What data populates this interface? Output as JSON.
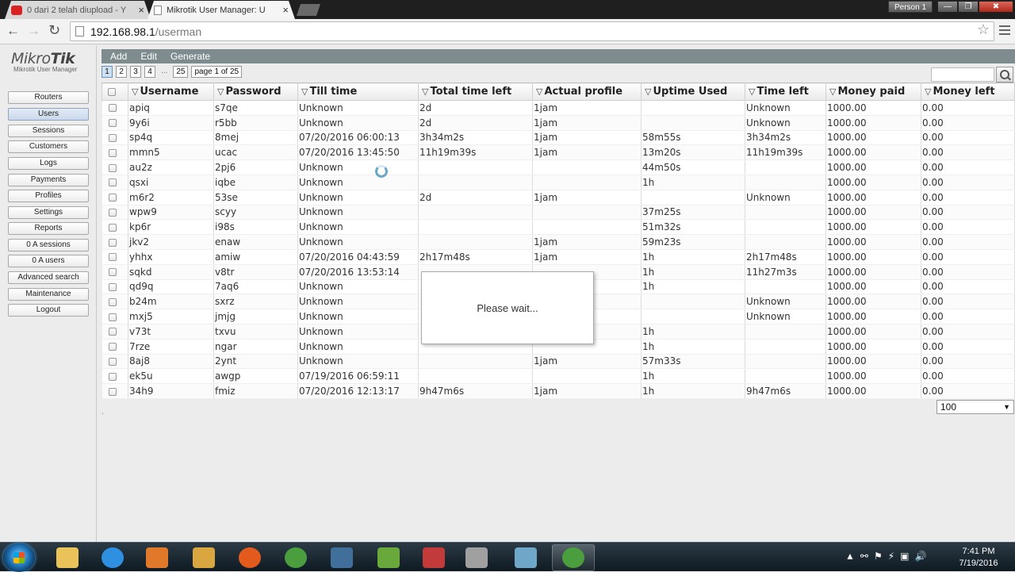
{
  "browser": {
    "tabs": [
      {
        "title": "0 dari 2 telah diupload - Y",
        "active": false
      },
      {
        "title": "Mikrotik User Manager: U",
        "active": true
      }
    ],
    "profile": "Person 1",
    "close_glyph": "×",
    "url_host": "192.168.98.1",
    "url_path": "/userman"
  },
  "logo": {
    "main_a": "Mikro",
    "main_b": "Tik",
    "sub": "Mikrotik User Manager"
  },
  "sidebar": {
    "items": [
      "Routers",
      "Users",
      "Sessions",
      "Customers",
      "Logs",
      "Payments",
      "Profiles",
      "Settings",
      "Reports",
      "0 A sessions",
      "0 A users",
      "Advanced search",
      "Maintenance",
      "Logout"
    ],
    "active": "Users"
  },
  "actions": {
    "add": "Add",
    "edit": "Edit",
    "generate": "Generate"
  },
  "pager": {
    "pages": [
      "1",
      "2",
      "3",
      "4"
    ],
    "dots": "...",
    "last": "25",
    "info": "page 1 of 25"
  },
  "table": {
    "sort_glyph": "▽",
    "columns": [
      "Username",
      "Password",
      "Till time",
      "Total time left",
      "Actual profile",
      "Uptime Used",
      "Time left",
      "Money paid",
      "Money left"
    ],
    "rows": [
      [
        "apiq",
        "s7qe",
        "Unknown",
        "2d",
        "1jam",
        "",
        "Unknown",
        "1000.00",
        "0.00"
      ],
      [
        "9y6i",
        "r5bb",
        "Unknown",
        "2d",
        "1jam",
        "",
        "Unknown",
        "1000.00",
        "0.00"
      ],
      [
        "sp4q",
        "8mej",
        "07/20/2016 06:00:13",
        "3h34m2s",
        "1jam",
        "58m55s",
        "3h34m2s",
        "1000.00",
        "0.00"
      ],
      [
        "mmn5",
        "ucac",
        "07/20/2016 13:45:50",
        "11h19m39s",
        "1jam",
        "13m20s",
        "11h19m39s",
        "1000.00",
        "0.00"
      ],
      [
        "au2z",
        "2pj6",
        "Unknown",
        "",
        "",
        "44m50s",
        "",
        "1000.00",
        "0.00"
      ],
      [
        "qsxi",
        "iqbe",
        "Unknown",
        "",
        "",
        "1h",
        "",
        "1000.00",
        "0.00"
      ],
      [
        "m6r2",
        "53se",
        "Unknown",
        "2d",
        "1jam",
        "",
        "Unknown",
        "1000.00",
        "0.00"
      ],
      [
        "wpw9",
        "scyy",
        "Unknown",
        "",
        "",
        "37m25s",
        "",
        "1000.00",
        "0.00"
      ],
      [
        "kp6r",
        "i98s",
        "Unknown",
        "",
        "",
        "51m32s",
        "",
        "1000.00",
        "0.00"
      ],
      [
        "jkv2",
        "enaw",
        "Unknown",
        "",
        "1jam",
        "59m23s",
        "",
        "1000.00",
        "0.00"
      ],
      [
        "yhhx",
        "amiw",
        "07/20/2016 04:43:59",
        "2h17m48s",
        "1jam",
        "1h",
        "2h17m48s",
        "1000.00",
        "0.00"
      ],
      [
        "sqkd",
        "v8tr",
        "07/20/2016 13:53:14",
        "",
        "",
        "1h",
        "11h27m3s",
        "1000.00",
        "0.00"
      ],
      [
        "qd9q",
        "7aq6",
        "Unknown",
        "",
        "",
        "1h",
        "",
        "1000.00",
        "0.00"
      ],
      [
        "b24m",
        "sxrz",
        "Unknown",
        "",
        "",
        "",
        "Unknown",
        "1000.00",
        "0.00"
      ],
      [
        "mxj5",
        "jmjg",
        "Unknown",
        "",
        "",
        "",
        "Unknown",
        "1000.00",
        "0.00"
      ],
      [
        "v73t",
        "txvu",
        "Unknown",
        "",
        "",
        "1h",
        "",
        "1000.00",
        "0.00"
      ],
      [
        "7rze",
        "ngar",
        "Unknown",
        "",
        "",
        "1h",
        "",
        "1000.00",
        "0.00"
      ],
      [
        "8aj8",
        "2ynt",
        "Unknown",
        "",
        "1jam",
        "57m33s",
        "",
        "1000.00",
        "0.00"
      ],
      [
        "ek5u",
        "awgp",
        "07/19/2016 06:59:11",
        "",
        "",
        "1h",
        "",
        "1000.00",
        "0.00"
      ],
      [
        "34h9",
        "fmiz",
        "07/20/2016 12:13:17",
        "9h47m6s",
        "1jam",
        "1h",
        "9h47m6s",
        "1000.00",
        "0.00"
      ]
    ]
  },
  "footer": {
    "dot": ".",
    "per_page": "100",
    "per_page_arrow": "▼"
  },
  "modal": {
    "text": "Please wait..."
  },
  "taskbar": {
    "apps": [
      "explorer-icon",
      "internet-explorer-icon",
      "media-player-icon",
      "winamp-icon",
      "firefox-icon",
      "chrome-icon",
      "sb-icon",
      "stack-icon",
      "office-icon",
      "camera-icon",
      "notepad-icon",
      "chrome-running-icon"
    ],
    "clock_time": "7:41 PM",
    "clock_date": "7/19/2016"
  }
}
